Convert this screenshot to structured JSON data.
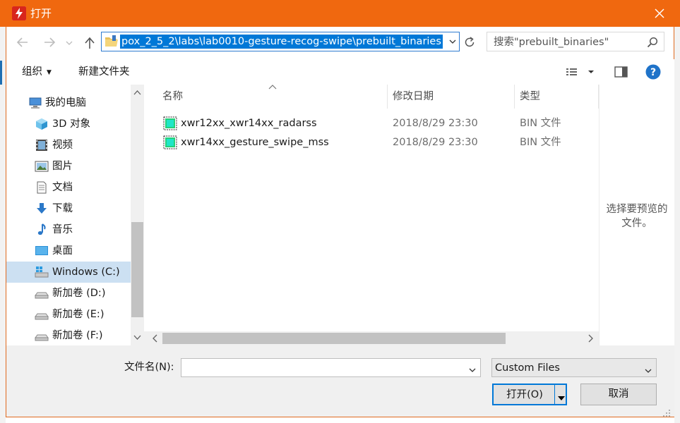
{
  "window": {
    "title": "打开",
    "accent": "#f0680f"
  },
  "address": {
    "path": "pox_2_5_2\\labs\\lab0010-gesture-recog-swipe\\prebuilt_binaries"
  },
  "search": {
    "placeholder": "搜索\"prebuilt_binaries\""
  },
  "toolbar": {
    "organize_label": "组织",
    "new_folder_label": "新建文件夹"
  },
  "sidebar": {
    "items": [
      {
        "label": "我的电脑",
        "icon": "computer-icon"
      },
      {
        "label": "3D 对象",
        "icon": "3d-objects-icon"
      },
      {
        "label": "视频",
        "icon": "video-icon"
      },
      {
        "label": "图片",
        "icon": "pictures-icon"
      },
      {
        "label": "文档",
        "icon": "documents-icon"
      },
      {
        "label": "下载",
        "icon": "download-icon"
      },
      {
        "label": "音乐",
        "icon": "music-icon"
      },
      {
        "label": "桌面",
        "icon": "desktop-icon"
      },
      {
        "label": "Windows (C:)",
        "icon": "windows-drive-icon",
        "selected": true
      },
      {
        "label": "新加卷 (D:)",
        "icon": "drive-icon"
      },
      {
        "label": "新加卷 (E:)",
        "icon": "drive-icon"
      },
      {
        "label": "新加卷 (F:)",
        "icon": "drive-icon"
      }
    ]
  },
  "filelist": {
    "columns": {
      "name": "名称",
      "date": "修改日期",
      "type": "类型"
    },
    "rows": [
      {
        "name": "xwr12xx_xwr14xx_radarss",
        "date": "2018/8/29 23:30",
        "type": "BIN 文件",
        "icon": "bin-file-icon"
      },
      {
        "name": "xwr14xx_gesture_swipe_mss",
        "date": "2018/8/29 23:30",
        "type": "BIN 文件",
        "icon": "bin-file-icon"
      }
    ]
  },
  "preview": {
    "text": "选择要预览的文件。"
  },
  "footer": {
    "filename_label": "文件名(N):",
    "filename_value": "",
    "filter_value": "Custom Files",
    "open_label": "打开(O)",
    "cancel_label": "取消"
  }
}
